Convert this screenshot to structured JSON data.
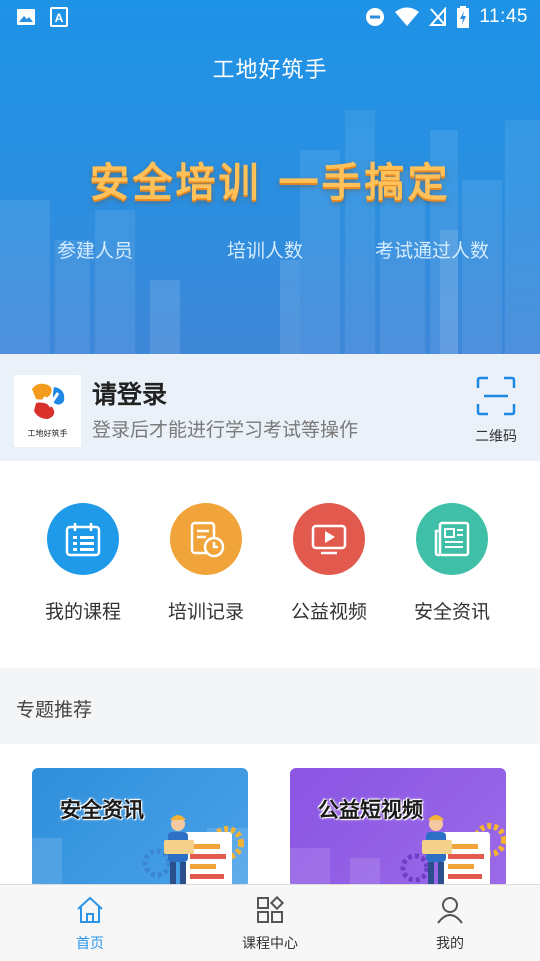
{
  "status_bar": {
    "time": "11:45"
  },
  "header": {
    "app_title": "工地好筑手",
    "slogan": "安全培训  一手搞定",
    "stats": [
      {
        "label": "参建人员"
      },
      {
        "label": "培训人数"
      },
      {
        "label": "考试通过人数"
      }
    ]
  },
  "login": {
    "logo_text": "工地好筑手",
    "title": "请登录",
    "subtitle": "登录后才能进行学习考试等操作",
    "scan_label": "二维码"
  },
  "quick_actions": [
    {
      "label": "我的课程",
      "icon": "calendar-icon",
      "color": "#1e9ae8"
    },
    {
      "label": "培训记录",
      "icon": "clock-document-icon",
      "color": "#f0a43a"
    },
    {
      "label": "公益视频",
      "icon": "video-icon",
      "color": "#e25a4e"
    },
    {
      "label": "安全资讯",
      "icon": "news-icon",
      "color": "#3fbfa7"
    }
  ],
  "section": {
    "title": "专题推荐"
  },
  "topics": [
    {
      "title": "安全资讯",
      "color": "#2b8fe0"
    },
    {
      "title": "公益短视频",
      "color": "#8a55e3"
    }
  ],
  "tabbar": {
    "items": [
      {
        "label": "首页",
        "active": true
      },
      {
        "label": "课程中心",
        "active": false
      },
      {
        "label": "我的",
        "active": false
      }
    ],
    "active_color": "#2b95e9"
  }
}
